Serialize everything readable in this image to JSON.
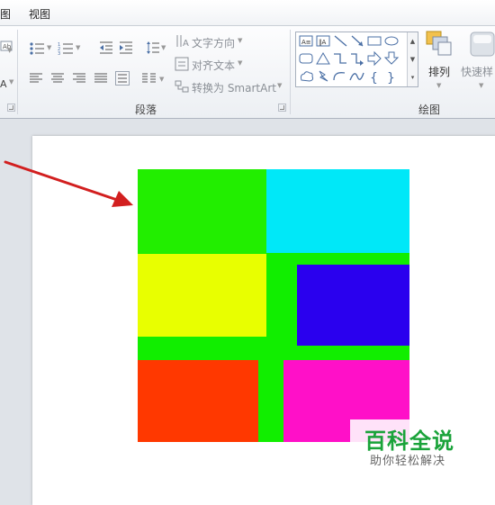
{
  "tabs": {
    "partial_left": "图",
    "view": "视图"
  },
  "paragraph_group": {
    "text_direction": "文字方向",
    "align_text": "对齐文本",
    "convert_smartart": "转换为 SmartArt",
    "label": "段落"
  },
  "drawing_group": {
    "arrange": "排列",
    "quick_styles": "快速样",
    "label": "绘图"
  },
  "slide": {
    "blocks": [
      {
        "name": "top-left-green",
        "color": "#22ee00"
      },
      {
        "name": "top-right-cyan",
        "color": "#00e8f8"
      },
      {
        "name": "mid-left-yellow",
        "color": "#e8ff00"
      },
      {
        "name": "mid-right-blue",
        "color": "#2a00ee"
      },
      {
        "name": "bottom-left-red",
        "color": "#ff3800"
      },
      {
        "name": "bottom-right-magenta",
        "color": "#ff10c8"
      }
    ],
    "background_color": "#11ee00"
  },
  "annotation": {
    "arrow_color": "#d21f1f"
  },
  "watermark": {
    "title": "百科全说",
    "subtitle": "助你轻松解决"
  }
}
